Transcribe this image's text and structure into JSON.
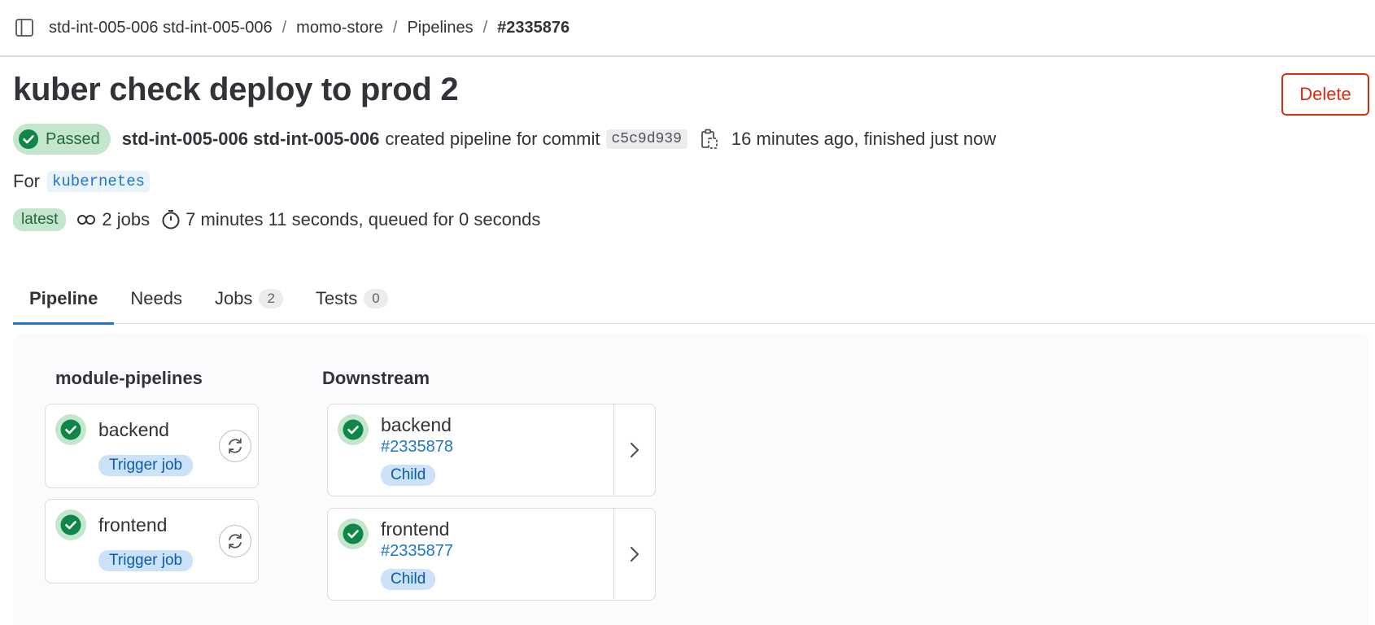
{
  "breadcrumb": {
    "items": [
      "std-int-005-006 std-int-005-006",
      "momo-store",
      "Pipelines",
      "#2335876"
    ],
    "separator": "/"
  },
  "header": {
    "title": "kuber check deploy to prod 2",
    "delete_label": "Delete"
  },
  "meta": {
    "status": "Passed",
    "author": "std-int-005-006 std-int-005-006",
    "action_text": "created pipeline for commit",
    "commit_sha": "c5c9d939",
    "time_text": "16 minutes ago, finished just now",
    "for_label": "For",
    "ref": "kubernetes",
    "latest_badge": "latest",
    "jobs_text": "2 jobs",
    "duration_text": "7 minutes 11 seconds, queued for 0 seconds"
  },
  "tabs": [
    {
      "label": "Pipeline",
      "count": ""
    },
    {
      "label": "Needs",
      "count": ""
    },
    {
      "label": "Jobs",
      "count": "2"
    },
    {
      "label": "Tests",
      "count": "0"
    }
  ],
  "stages": {
    "module": {
      "title": "module-pipelines",
      "jobs": [
        {
          "name": "backend",
          "badge": "Trigger job"
        },
        {
          "name": "frontend",
          "badge": "Trigger job"
        }
      ]
    },
    "downstream": {
      "title": "Downstream",
      "pipelines": [
        {
          "name": "backend",
          "id": "#2335878",
          "badge": "Child"
        },
        {
          "name": "frontend",
          "id": "#2335877",
          "badge": "Child"
        }
      ]
    }
  },
  "colors": {
    "success": "#108548",
    "success_bg": "#c3e6cd",
    "link": "#1f75cb",
    "danger": "#dd2b0e"
  },
  "icons": [
    "sidebar-icon",
    "check-circle-icon",
    "copy-icon",
    "pipeline-jobs-icon",
    "timer-icon",
    "retry-icon",
    "chevron-right-icon"
  ]
}
